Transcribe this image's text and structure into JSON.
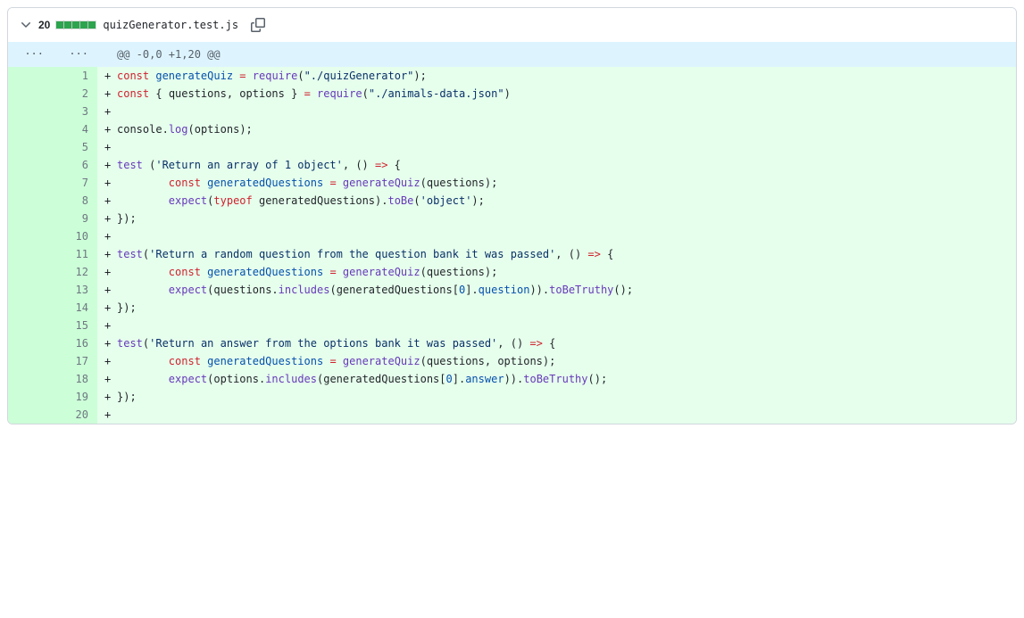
{
  "file": {
    "line_count": "20",
    "name": "quizGenerator.test.js",
    "diffstat_blocks": 5
  },
  "hunk_header": "@@ -0,0 +1,20 @@",
  "lines": [
    {
      "old": "",
      "new": "1",
      "marker": "+",
      "tokens": [
        [
          "pl-k",
          "const"
        ],
        [
          "",
          " "
        ],
        [
          "pl-c1",
          "generateQuiz"
        ],
        [
          "",
          " "
        ],
        [
          "pl-k",
          "="
        ],
        [
          "",
          " "
        ],
        [
          "pl-en",
          "require"
        ],
        [
          "",
          "("
        ],
        [
          "pl-s",
          "\"./quizGenerator\""
        ],
        [
          "",
          ");"
        ]
      ]
    },
    {
      "old": "",
      "new": "2",
      "marker": "+",
      "tokens": [
        [
          "pl-k",
          "const"
        ],
        [
          "",
          " { "
        ],
        [
          "pl-smi",
          "questions"
        ],
        [
          "",
          ", "
        ],
        [
          "pl-smi",
          "options"
        ],
        [
          "",
          " } "
        ],
        [
          "pl-k",
          "="
        ],
        [
          "",
          " "
        ],
        [
          "pl-en",
          "require"
        ],
        [
          "",
          "("
        ],
        [
          "pl-s",
          "\"./animals-data.json\""
        ],
        [
          "",
          ")"
        ]
      ]
    },
    {
      "old": "",
      "new": "3",
      "marker": "+",
      "tokens": []
    },
    {
      "old": "",
      "new": "4",
      "marker": "+",
      "tokens": [
        [
          "pl-smi",
          "console"
        ],
        [
          "",
          "."
        ],
        [
          "pl-en",
          "log"
        ],
        [
          "",
          "("
        ],
        [
          "pl-smi",
          "options"
        ],
        [
          "",
          ");"
        ]
      ]
    },
    {
      "old": "",
      "new": "5",
      "marker": "+",
      "tokens": []
    },
    {
      "old": "",
      "new": "6",
      "marker": "+",
      "tokens": [
        [
          "pl-en",
          "test"
        ],
        [
          "",
          " ("
        ],
        [
          "pl-s",
          "'Return an array of 1 object'"
        ],
        [
          "",
          ", () "
        ],
        [
          "pl-k",
          "=>"
        ],
        [
          "",
          " {"
        ]
      ]
    },
    {
      "old": "",
      "new": "7",
      "marker": "+",
      "tokens": [
        [
          "",
          "        "
        ],
        [
          "pl-k",
          "const"
        ],
        [
          "",
          " "
        ],
        [
          "pl-c1",
          "generatedQuestions"
        ],
        [
          "",
          " "
        ],
        [
          "pl-k",
          "="
        ],
        [
          "",
          " "
        ],
        [
          "pl-en",
          "generateQuiz"
        ],
        [
          "",
          "("
        ],
        [
          "pl-smi",
          "questions"
        ],
        [
          "",
          ");"
        ]
      ]
    },
    {
      "old": "",
      "new": "8",
      "marker": "+",
      "tokens": [
        [
          "",
          "        "
        ],
        [
          "pl-en",
          "expect"
        ],
        [
          "",
          "("
        ],
        [
          "pl-k",
          "typeof"
        ],
        [
          "",
          " "
        ],
        [
          "pl-smi",
          "generatedQuestions"
        ],
        [
          "",
          ")."
        ],
        [
          "pl-en",
          "toBe"
        ],
        [
          "",
          "("
        ],
        [
          "pl-s",
          "'object'"
        ],
        [
          "",
          ");"
        ]
      ]
    },
    {
      "old": "",
      "new": "9",
      "marker": "+",
      "tokens": [
        [
          "",
          "});"
        ]
      ]
    },
    {
      "old": "",
      "new": "10",
      "marker": "+",
      "tokens": []
    },
    {
      "old": "",
      "new": "11",
      "marker": "+",
      "tokens": [
        [
          "pl-en",
          "test"
        ],
        [
          "",
          "("
        ],
        [
          "pl-s",
          "'Return a random question from the question bank it was passed'"
        ],
        [
          "",
          ", () "
        ],
        [
          "pl-k",
          "=>"
        ],
        [
          "",
          " {"
        ]
      ]
    },
    {
      "old": "",
      "new": "12",
      "marker": "+",
      "tokens": [
        [
          "",
          "        "
        ],
        [
          "pl-k",
          "const"
        ],
        [
          "",
          " "
        ],
        [
          "pl-c1",
          "generatedQuestions"
        ],
        [
          "",
          " "
        ],
        [
          "pl-k",
          "="
        ],
        [
          "",
          " "
        ],
        [
          "pl-en",
          "generateQuiz"
        ],
        [
          "",
          "("
        ],
        [
          "pl-smi",
          "questions"
        ],
        [
          "",
          ");"
        ]
      ]
    },
    {
      "old": "",
      "new": "13",
      "marker": "+",
      "tokens": [
        [
          "",
          "        "
        ],
        [
          "pl-en",
          "expect"
        ],
        [
          "",
          "("
        ],
        [
          "pl-smi",
          "questions"
        ],
        [
          "",
          "."
        ],
        [
          "pl-en",
          "includes"
        ],
        [
          "",
          "("
        ],
        [
          "pl-smi",
          "generatedQuestions"
        ],
        [
          "",
          "["
        ],
        [
          "pl-c1",
          "0"
        ],
        [
          "",
          "]."
        ],
        [
          "pl-c1",
          "question"
        ],
        [
          "",
          "))."
        ],
        [
          "pl-en",
          "toBeTruthy"
        ],
        [
          "",
          "();"
        ]
      ]
    },
    {
      "old": "",
      "new": "14",
      "marker": "+",
      "tokens": [
        [
          "",
          "});"
        ]
      ]
    },
    {
      "old": "",
      "new": "15",
      "marker": "+",
      "tokens": []
    },
    {
      "old": "",
      "new": "16",
      "marker": "+",
      "tokens": [
        [
          "pl-en",
          "test"
        ],
        [
          "",
          "("
        ],
        [
          "pl-s",
          "'Return an answer from the options bank it was passed'"
        ],
        [
          "",
          ", () "
        ],
        [
          "pl-k",
          "=>"
        ],
        [
          "",
          " {"
        ]
      ]
    },
    {
      "old": "",
      "new": "17",
      "marker": "+",
      "tokens": [
        [
          "",
          "        "
        ],
        [
          "pl-k",
          "const"
        ],
        [
          "",
          " "
        ],
        [
          "pl-c1",
          "generatedQuestions"
        ],
        [
          "",
          " "
        ],
        [
          "pl-k",
          "="
        ],
        [
          "",
          " "
        ],
        [
          "pl-en",
          "generateQuiz"
        ],
        [
          "",
          "("
        ],
        [
          "pl-smi",
          "questions"
        ],
        [
          "",
          ", "
        ],
        [
          "pl-smi",
          "options"
        ],
        [
          "",
          ");"
        ]
      ]
    },
    {
      "old": "",
      "new": "18",
      "marker": "+",
      "tokens": [
        [
          "",
          "        "
        ],
        [
          "pl-en",
          "expect"
        ],
        [
          "",
          "("
        ],
        [
          "pl-smi",
          "options"
        ],
        [
          "",
          "."
        ],
        [
          "pl-en",
          "includes"
        ],
        [
          "",
          "("
        ],
        [
          "pl-smi",
          "generatedQuestions"
        ],
        [
          "",
          "["
        ],
        [
          "pl-c1",
          "0"
        ],
        [
          "",
          "]."
        ],
        [
          "pl-c1",
          "answer"
        ],
        [
          "",
          "))."
        ],
        [
          "pl-en",
          "toBeTruthy"
        ],
        [
          "",
          "();"
        ]
      ]
    },
    {
      "old": "",
      "new": "19",
      "marker": "+",
      "tokens": [
        [
          "",
          "});"
        ]
      ]
    },
    {
      "old": "",
      "new": "20",
      "marker": "+",
      "tokens": []
    }
  ]
}
